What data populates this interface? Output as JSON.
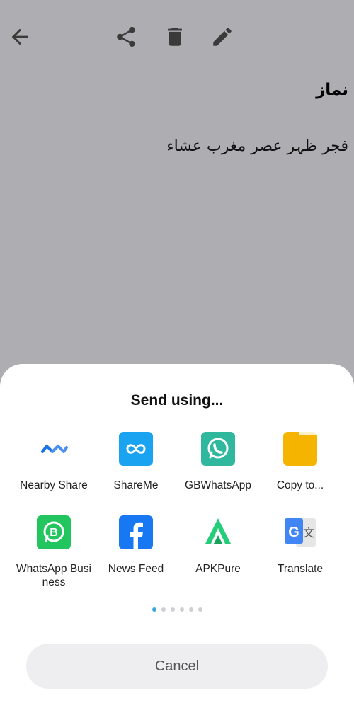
{
  "note": {
    "title": "نماز",
    "body": "فجر ظہر عصر مغرب عشاء"
  },
  "toolbar": {
    "icons": [
      "back-arrow-icon",
      "share-icon",
      "delete-icon",
      "edit-icon"
    ]
  },
  "share_sheet": {
    "title": "Send using...",
    "apps": [
      {
        "label": "Nearby Share",
        "icon": "nearby-share-icon",
        "color": "#1a73e8"
      },
      {
        "label": "ShareMe",
        "icon": "shareme-icon",
        "color": "#1aa3f0"
      },
      {
        "label": "GBWhatsApp",
        "icon": "gbwhatsapp-icon",
        "color": "#2fb89e"
      },
      {
        "label": "Copy to...",
        "icon": "copy-to-icon",
        "color": "#f5b400"
      },
      {
        "label": "WhatsApp Business",
        "icon": "whatsapp-business-icon",
        "color": "#22c55e"
      },
      {
        "label": "News Feed",
        "icon": "facebook-icon",
        "color": "#1877f2"
      },
      {
        "label": "APKPure",
        "icon": "apkpure-icon",
        "color": "#24cd77"
      },
      {
        "label": "Translate",
        "icon": "google-translate-icon",
        "color": "#4285f4"
      }
    ],
    "page_indicator": {
      "total": 6,
      "active": 1
    },
    "cancel_label": "Cancel"
  }
}
